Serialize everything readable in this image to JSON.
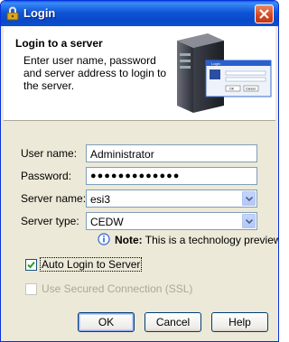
{
  "window": {
    "title": "Login"
  },
  "header": {
    "title": "Login to a server",
    "description": "Enter user name, password and server address to login to the server.",
    "art": {
      "mini_title": "Login",
      "ok_label": "OK",
      "cancel_label": "Cancel"
    }
  },
  "form": {
    "username": {
      "label": "User name:",
      "value": "Administrator"
    },
    "password": {
      "label": "Password:",
      "value": "●●●●●●●●●●●●●"
    },
    "server_name": {
      "label": "Server name:",
      "value": "esi3"
    },
    "server_type": {
      "label": "Server type:",
      "value": "CEDW"
    },
    "note": {
      "bold": "Note:",
      "text": " This is a technology preview."
    },
    "auto_login": {
      "label": "Auto Login to Server",
      "checked": true
    },
    "secured": {
      "label": "Use Secured Connection (SSL)",
      "checked": false,
      "disabled": true
    }
  },
  "buttons": {
    "ok": "OK",
    "cancel": "Cancel",
    "help": "Help"
  },
  "colors": {
    "titlebar": "#0a55d8",
    "dialog_bg": "#ece9d8",
    "close": "#d3471d"
  }
}
